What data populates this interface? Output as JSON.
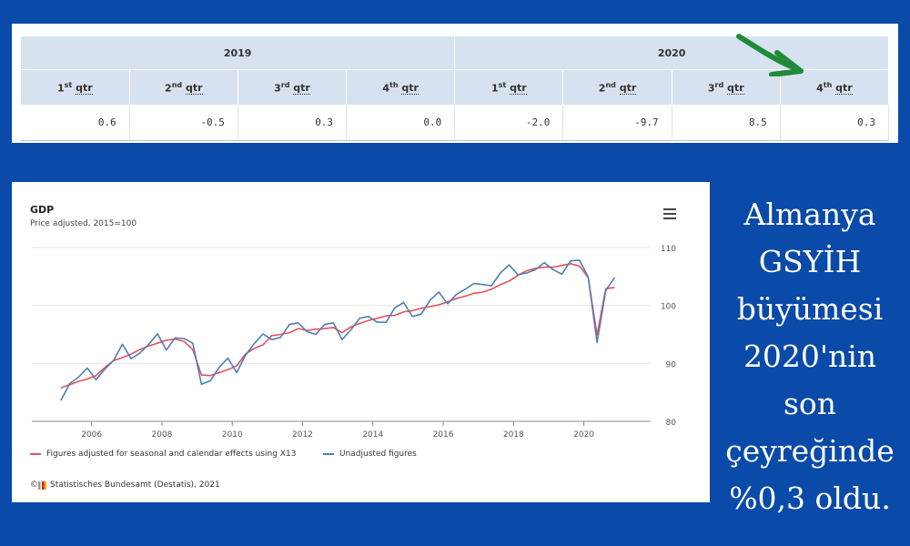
{
  "table": {
    "years": [
      "2019",
      "2020"
    ],
    "quarters": [
      {
        "num": "1",
        "sup": "st",
        "label": "qtr"
      },
      {
        "num": "2",
        "sup": "nd",
        "label": "qtr"
      },
      {
        "num": "3",
        "sup": "rd",
        "label": "qtr"
      },
      {
        "num": "4",
        "sup": "th",
        "label": "qtr"
      },
      {
        "num": "1",
        "sup": "st",
        "label": "qtr"
      },
      {
        "num": "2",
        "sup": "nd",
        "label": "qtr"
      },
      {
        "num": "3",
        "sup": "rd",
        "label": "qtr"
      },
      {
        "num": "4",
        "sup": "th",
        "label": "qtr"
      }
    ],
    "values": [
      "0.6",
      "-0.5",
      "0.3",
      "0.0",
      "-2.0",
      "-9.7",
      "8.5",
      "0.3"
    ],
    "header_bg": "#d6e2ef"
  },
  "annotation_arrow": {
    "icon": "green-arrow-icon",
    "color": "#1e8a3a"
  },
  "side_text": [
    "Almanya",
    "GSYİH",
    "büyümesi",
    "2020'nin",
    "son",
    "çeyreğinde",
    "%0,3 oldu."
  ],
  "chart_data": {
    "type": "line",
    "title": "GDP",
    "subtitle": "Price adjusted, 2015=100",
    "xlim": [
      2004.3,
      2021.9
    ],
    "ylim": [
      80,
      110
    ],
    "xticks": [
      "2006",
      "2008",
      "2010",
      "2012",
      "2014",
      "2016",
      "2018",
      "2020"
    ],
    "yticks": [
      "80",
      "90",
      "100",
      "110"
    ],
    "menu_icon": "hamburger-menu-icon",
    "source": "Statistisches Bundesamt (Destatis), 2021",
    "legend_position": "bottom-left",
    "series": [
      {
        "name": "Figures adjusted for seasonal and calendar effects using X13",
        "color": "#e8505b",
        "x": [
          2005.125,
          2005.375,
          2005.625,
          2005.875,
          2006.125,
          2006.375,
          2006.625,
          2006.875,
          2007.125,
          2007.375,
          2007.625,
          2007.875,
          2008.125,
          2008.375,
          2008.625,
          2008.875,
          2009.125,
          2009.375,
          2009.625,
          2009.875,
          2010.125,
          2010.375,
          2010.625,
          2010.875,
          2011.125,
          2011.375,
          2011.625,
          2011.875,
          2012.125,
          2012.375,
          2012.625,
          2012.875,
          2013.125,
          2013.375,
          2013.625,
          2013.875,
          2014.125,
          2014.375,
          2014.625,
          2014.875,
          2015.125,
          2015.375,
          2015.625,
          2015.875,
          2016.125,
          2016.375,
          2016.625,
          2016.875,
          2017.125,
          2017.375,
          2017.625,
          2017.875,
          2018.125,
          2018.375,
          2018.625,
          2018.875,
          2019.125,
          2019.375,
          2019.625,
          2019.875,
          2020.125,
          2020.375,
          2020.625,
          2020.875
        ],
        "values": [
          85.8,
          86.3,
          86.9,
          87.3,
          87.9,
          89.3,
          90.5,
          91.0,
          91.6,
          92.4,
          93.0,
          93.5,
          94.0,
          94.2,
          93.8,
          92.4,
          88.0,
          87.9,
          88.4,
          88.9,
          89.6,
          91.6,
          92.6,
          93.2,
          94.8,
          95.0,
          95.3,
          96.0,
          95.7,
          95.9,
          96.0,
          96.2,
          95.3,
          96.3,
          96.9,
          97.4,
          97.8,
          98.2,
          98.3,
          98.9,
          99.1,
          99.5,
          99.8,
          100.1,
          100.6,
          101.2,
          101.6,
          102.1,
          102.3,
          102.8,
          103.6,
          104.2,
          105.2,
          106.0,
          106.4,
          106.6,
          106.6,
          106.9,
          107.2,
          106.8,
          104.8,
          94.9,
          102.9,
          103.1
        ]
      },
      {
        "name": "Unadjusted figures",
        "color": "#4f7fb0",
        "x": [
          2005.125,
          2005.375,
          2005.625,
          2005.875,
          2006.125,
          2006.375,
          2006.625,
          2006.875,
          2007.125,
          2007.375,
          2007.625,
          2007.875,
          2008.125,
          2008.375,
          2008.625,
          2008.875,
          2009.125,
          2009.375,
          2009.625,
          2009.875,
          2010.125,
          2010.375,
          2010.625,
          2010.875,
          2011.125,
          2011.375,
          2011.625,
          2011.875,
          2012.125,
          2012.375,
          2012.625,
          2012.875,
          2013.125,
          2013.375,
          2013.625,
          2013.875,
          2014.125,
          2014.375,
          2014.625,
          2014.875,
          2015.125,
          2015.375,
          2015.625,
          2015.875,
          2016.125,
          2016.375,
          2016.625,
          2016.875,
          2017.125,
          2017.375,
          2017.625,
          2017.875,
          2018.125,
          2018.375,
          2018.625,
          2018.875,
          2019.125,
          2019.375,
          2019.625,
          2019.875,
          2020.125,
          2020.375,
          2020.625,
          2020.875
        ],
        "values": [
          83.6,
          86.5,
          87.6,
          89.2,
          87.2,
          89.0,
          90.5,
          93.3,
          90.8,
          91.8,
          93.3,
          95.1,
          92.3,
          94.4,
          94.3,
          93.5,
          86.4,
          87.0,
          89.3,
          90.9,
          88.4,
          91.4,
          93.4,
          95.1,
          94.1,
          94.5,
          96.7,
          97.0,
          95.5,
          95.0,
          96.7,
          97.0,
          94.1,
          95.8,
          97.8,
          98.1,
          97.1,
          97.1,
          99.6,
          100.5,
          98.1,
          98.5,
          100.9,
          102.3,
          100.3,
          101.9,
          102.8,
          103.8,
          103.6,
          103.4,
          105.6,
          107.0,
          105.3,
          105.6,
          106.2,
          107.4,
          106.2,
          105.4,
          107.7,
          107.8,
          104.9,
          93.6,
          102.6,
          104.8
        ]
      }
    ]
  }
}
